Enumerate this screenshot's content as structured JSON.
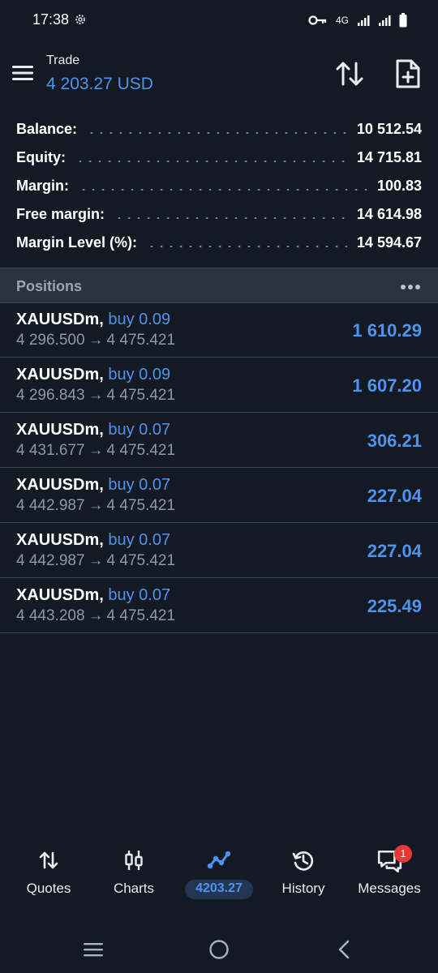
{
  "status_bar": {
    "time": "17:38",
    "network": "4G",
    "icons": [
      "settings-icon",
      "key-icon",
      "signal-icon",
      "battery-icon"
    ]
  },
  "header": {
    "title": "Trade",
    "balance": "4 203.27 USD",
    "icons": [
      "menu-icon",
      "sort-icon",
      "new-order-icon"
    ]
  },
  "summary": [
    {
      "label": "Balance:",
      "value": "10 512.54"
    },
    {
      "label": "Equity:",
      "value": "14 715.81"
    },
    {
      "label": "Margin:",
      "value": "100.83"
    },
    {
      "label": "Free margin:",
      "value": "14 614.98"
    },
    {
      "label": "Margin Level (%):",
      "value": "14 594.67"
    }
  ],
  "positions_header": {
    "title": "Positions"
  },
  "positions": [
    {
      "symbol": "XAUUSDm,",
      "side": "buy 0.09",
      "open": "4 296.500",
      "arrow": "→",
      "current": "4 475.421",
      "profit": "1 610.29"
    },
    {
      "symbol": "XAUUSDm,",
      "side": "buy 0.09",
      "open": "4 296.843",
      "arrow": "→",
      "current": "4 475.421",
      "profit": "1 607.20"
    },
    {
      "symbol": "XAUUSDm,",
      "side": "buy 0.07",
      "open": "4 431.677",
      "arrow": "→",
      "current": "4 475.421",
      "profit": "306.21"
    },
    {
      "symbol": "XAUUSDm,",
      "side": "buy 0.07",
      "open": "4 442.987",
      "arrow": "→",
      "current": "4 475.421",
      "profit": "227.04"
    },
    {
      "symbol": "XAUUSDm,",
      "side": "buy 0.07",
      "open": "4 442.987",
      "arrow": "→",
      "current": "4 475.421",
      "profit": "227.04"
    },
    {
      "symbol": "XAUUSDm,",
      "side": "buy 0.07",
      "open": "4 443.208",
      "arrow": "→",
      "current": "4 475.421",
      "profit": "225.49"
    }
  ],
  "bottom_nav": {
    "items": [
      {
        "label": "Quotes",
        "icon": "quotes-icon"
      },
      {
        "label": "Charts",
        "icon": "charts-icon"
      },
      {
        "label": "4203.27",
        "icon": "trade-icon",
        "active": true
      },
      {
        "label": "History",
        "icon": "history-icon"
      },
      {
        "label": "Messages",
        "icon": "messages-icon",
        "badge": "1"
      }
    ]
  },
  "colors": {
    "background": "#131a24",
    "accent": "#4e93ee",
    "section_header": "#2a3340",
    "muted_text": "#8d98a8",
    "badge": "#e53935"
  }
}
